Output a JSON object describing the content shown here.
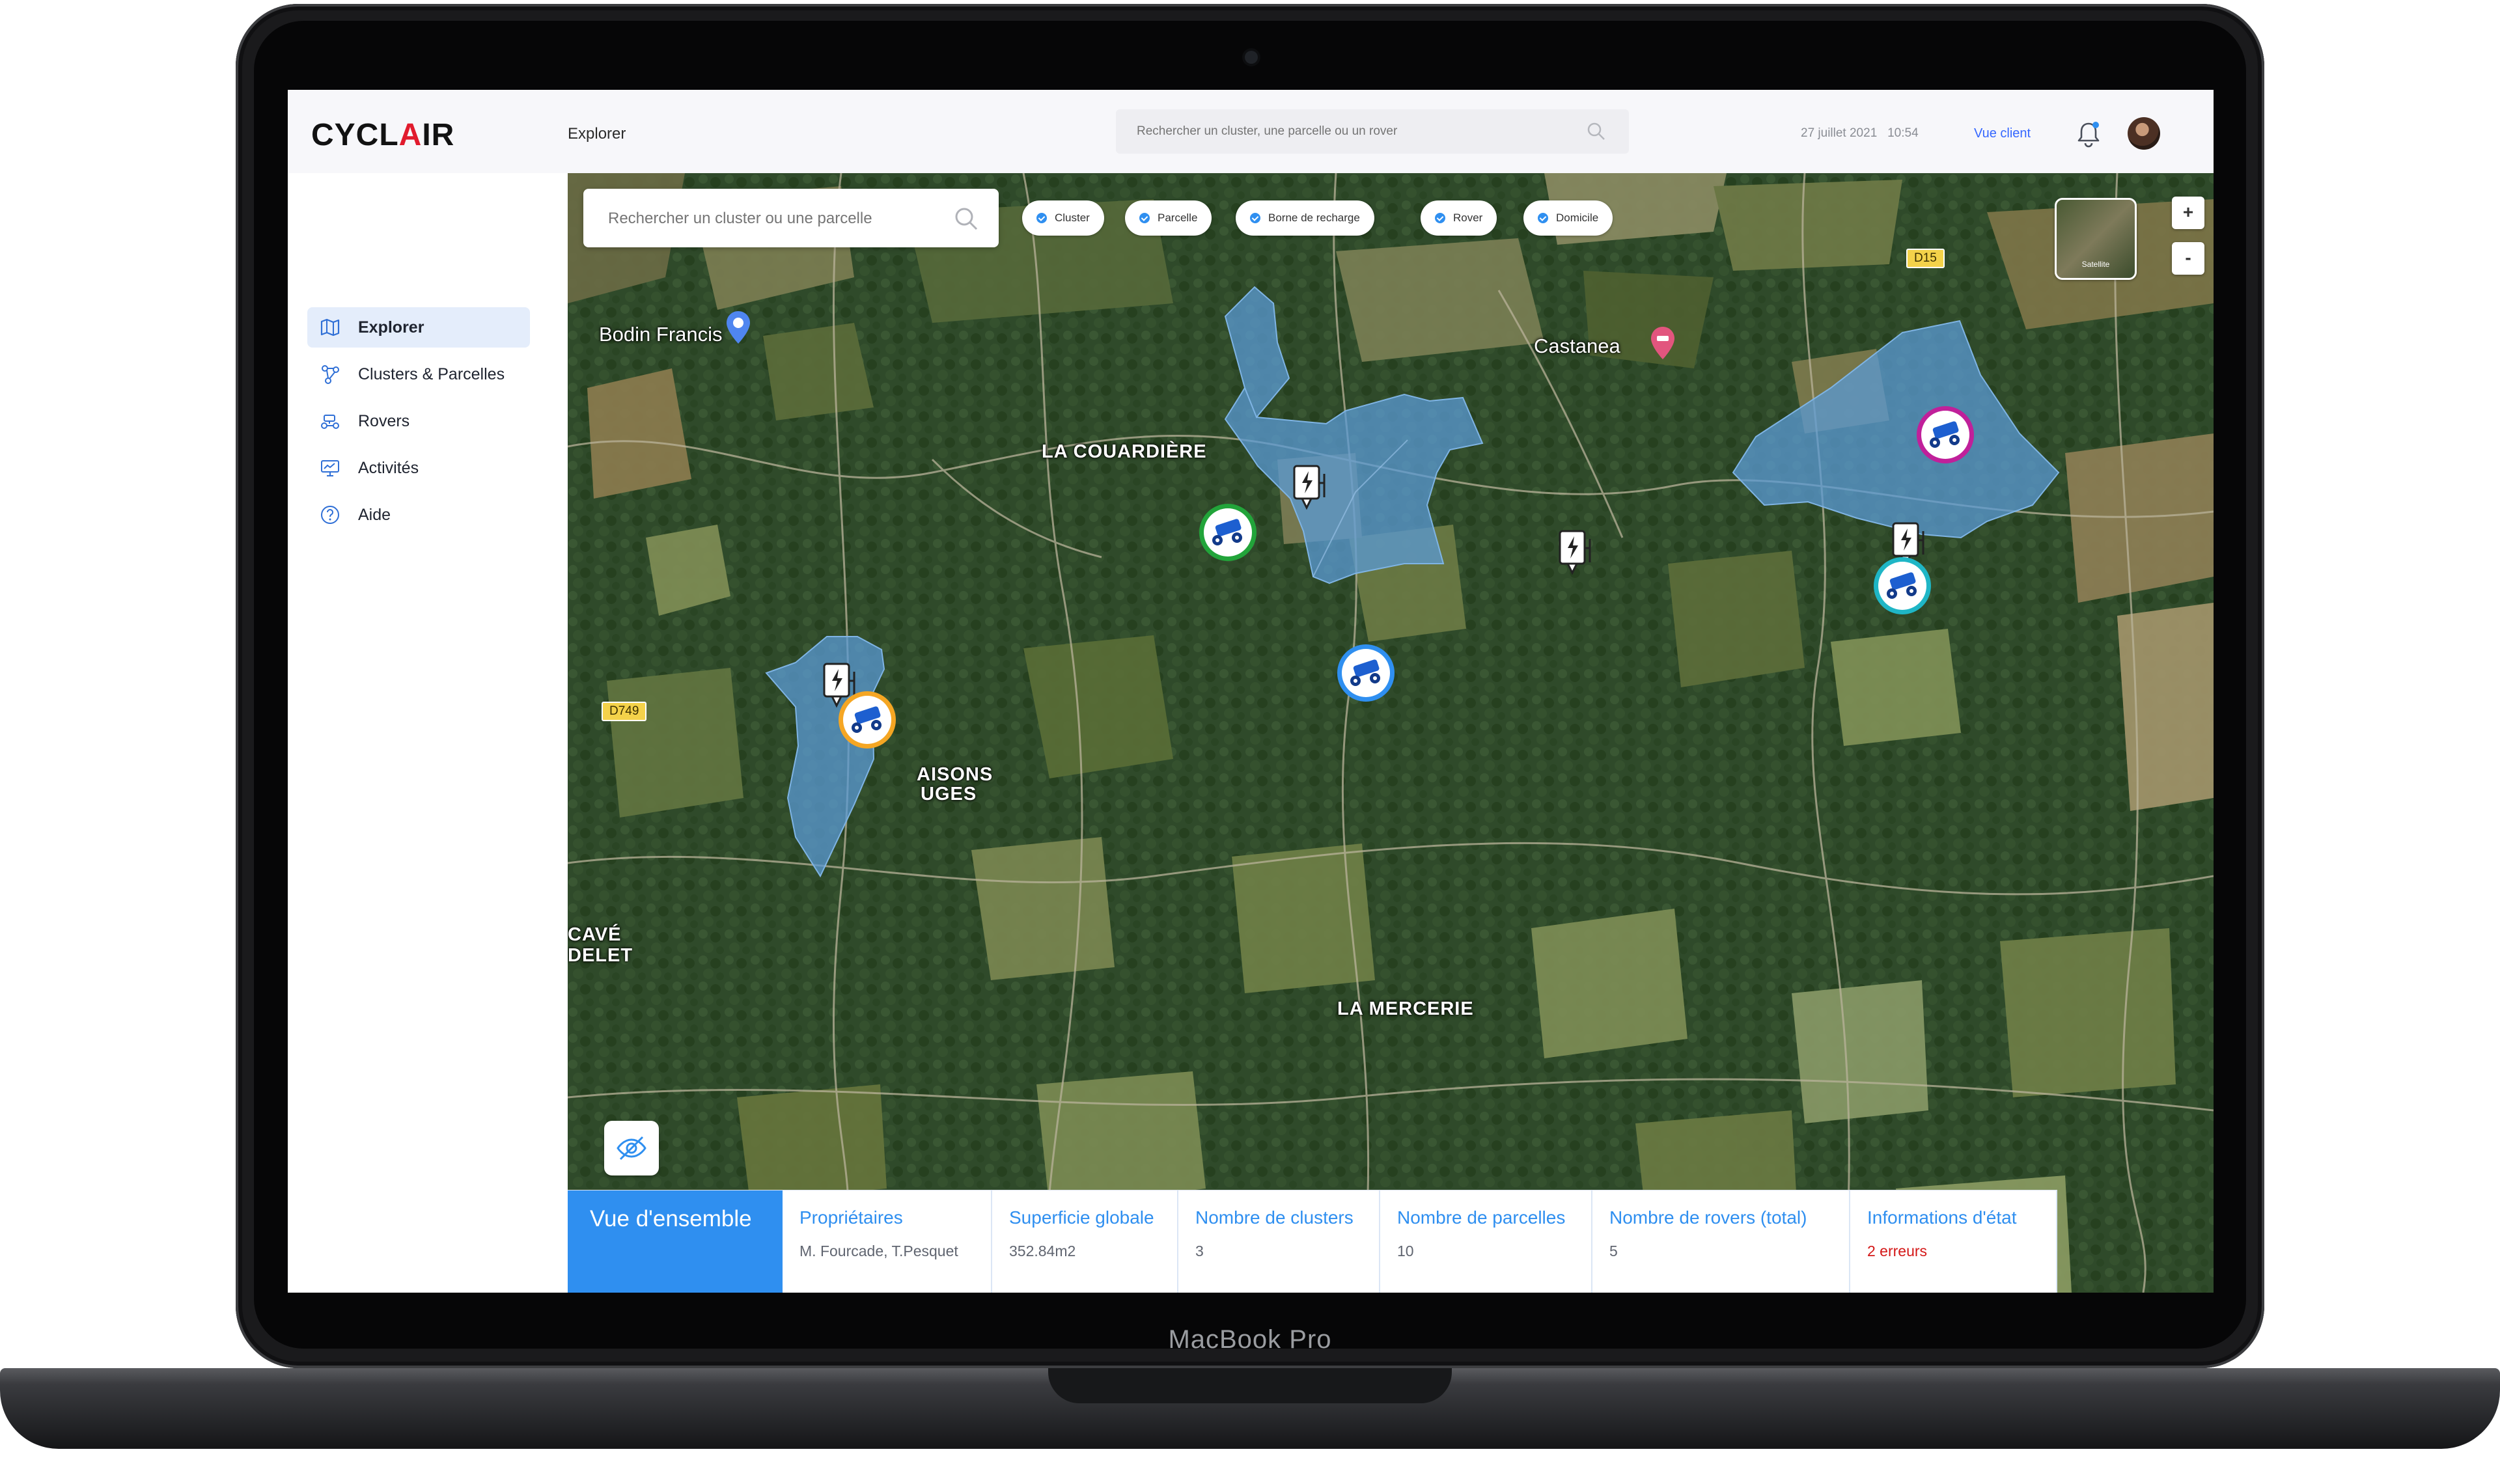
{
  "device": {
    "label": "MacBook Pro"
  },
  "app": {
    "logo": {
      "part1": "CYCL",
      "part2": "A",
      "part3": "IR"
    },
    "page_title": "Explorer",
    "search": {
      "placeholder": "Rechercher un cluster, une parcelle ou un rover"
    },
    "date": "27 juillet 2021",
    "time": "10:54",
    "view_client_label": "Vue client",
    "notification_dot_color": "#2f8ff0"
  },
  "sidebar": {
    "items": [
      {
        "label": "Explorer",
        "icon": "map-icon",
        "active": true
      },
      {
        "label": "Clusters & Parcelles",
        "icon": "cluster-icon",
        "active": false
      },
      {
        "label": "Rovers",
        "icon": "rover-icon",
        "active": false
      },
      {
        "label": "Activités",
        "icon": "monitor-icon",
        "active": false
      },
      {
        "label": "Aide",
        "icon": "help-icon",
        "active": false
      }
    ]
  },
  "map": {
    "search": {
      "placeholder": "Rechercher un cluster ou une parcelle"
    },
    "filters": [
      "Cluster",
      "Parcelle",
      "Borne de recharge",
      "Rover",
      "Domicile"
    ],
    "layer_label": "Satellite",
    "zoom_in": "+",
    "zoom_out": "-",
    "labels": {
      "bodin": "Bodin Francis",
      "castanea": "Castanea",
      "couardiere": "LA COUARDIÈRE",
      "maisons_1": "AISONS",
      "maisons_2": "UGES",
      "cave_1": "CAVÉ",
      "cave_2": "DELET",
      "mercerie": "LA MERCERIE"
    },
    "roads": {
      "d15": "D15",
      "d749": "D749"
    },
    "colors": {
      "parcel_fill": "#5b9bd5",
      "rover_green": "#22a43a",
      "rover_orange": "#f5a623",
      "rover_blue": "#2f8ff0",
      "rover_magenta": "#c0209a",
      "rover_teal": "#1fb6c6"
    }
  },
  "summary": {
    "title": "Vue d'ensemble",
    "fields": [
      {
        "label": "Propriétaires",
        "value": "M. Fourcade, T.Pesquet"
      },
      {
        "label": "Superficie globale",
        "value": "352.84m2"
      },
      {
        "label": "Nombre de clusters",
        "value": "3"
      },
      {
        "label": "Nombre de parcelles",
        "value": "10"
      },
      {
        "label": "Nombre de rovers (total)",
        "value": "5"
      },
      {
        "label": "Informations d'état",
        "value": "2 erreurs"
      }
    ]
  }
}
